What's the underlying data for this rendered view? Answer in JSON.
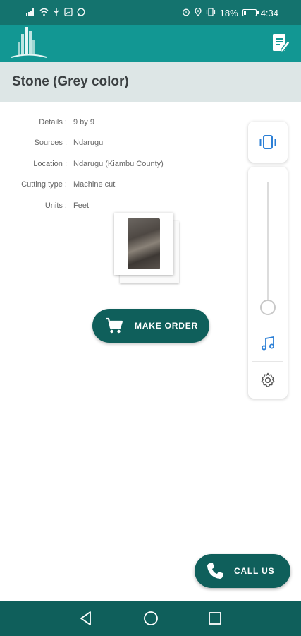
{
  "status_bar": {
    "left_icons": [
      "signal-icon",
      "wifi-icon",
      "usb-icon",
      "gallery-icon",
      "whatsapp-icon"
    ],
    "right_icons": [
      "alarm-icon",
      "location-icon",
      "vibrate-icon"
    ],
    "battery": "18%",
    "battery_level": 0.18,
    "time": "4:34"
  },
  "app_bar": {
    "logo_icon": "skyline-logo-icon",
    "action_icon": "document-edit-icon"
  },
  "title": "Stone (Grey color)",
  "details": [
    {
      "label": "Details :",
      "value": "9 by 9"
    },
    {
      "label": "Sources :",
      "value": "Ndarugu"
    },
    {
      "label": "Location :",
      "value": "Ndarugu (Kiambu County)"
    },
    {
      "label": "Cutting type :",
      "value": "Machine cut"
    },
    {
      "label": "Units :",
      "value": "Feet"
    }
  ],
  "make_order": {
    "label": "MAKE ORDER",
    "icon": "cart-icon"
  },
  "call_us": {
    "label": "CALL US",
    "icon": "phone-icon"
  },
  "volume_panel": {
    "mode_icon": "vibrate-icon",
    "media_icon": "music-note-icon",
    "settings_icon": "gear-icon",
    "level": 0.0
  },
  "colors": {
    "status_bar": "#14736e",
    "app_bar": "#129793",
    "title_band": "#dde6e6",
    "button": "#0f5f5b",
    "accent": "#2b7fd6"
  }
}
